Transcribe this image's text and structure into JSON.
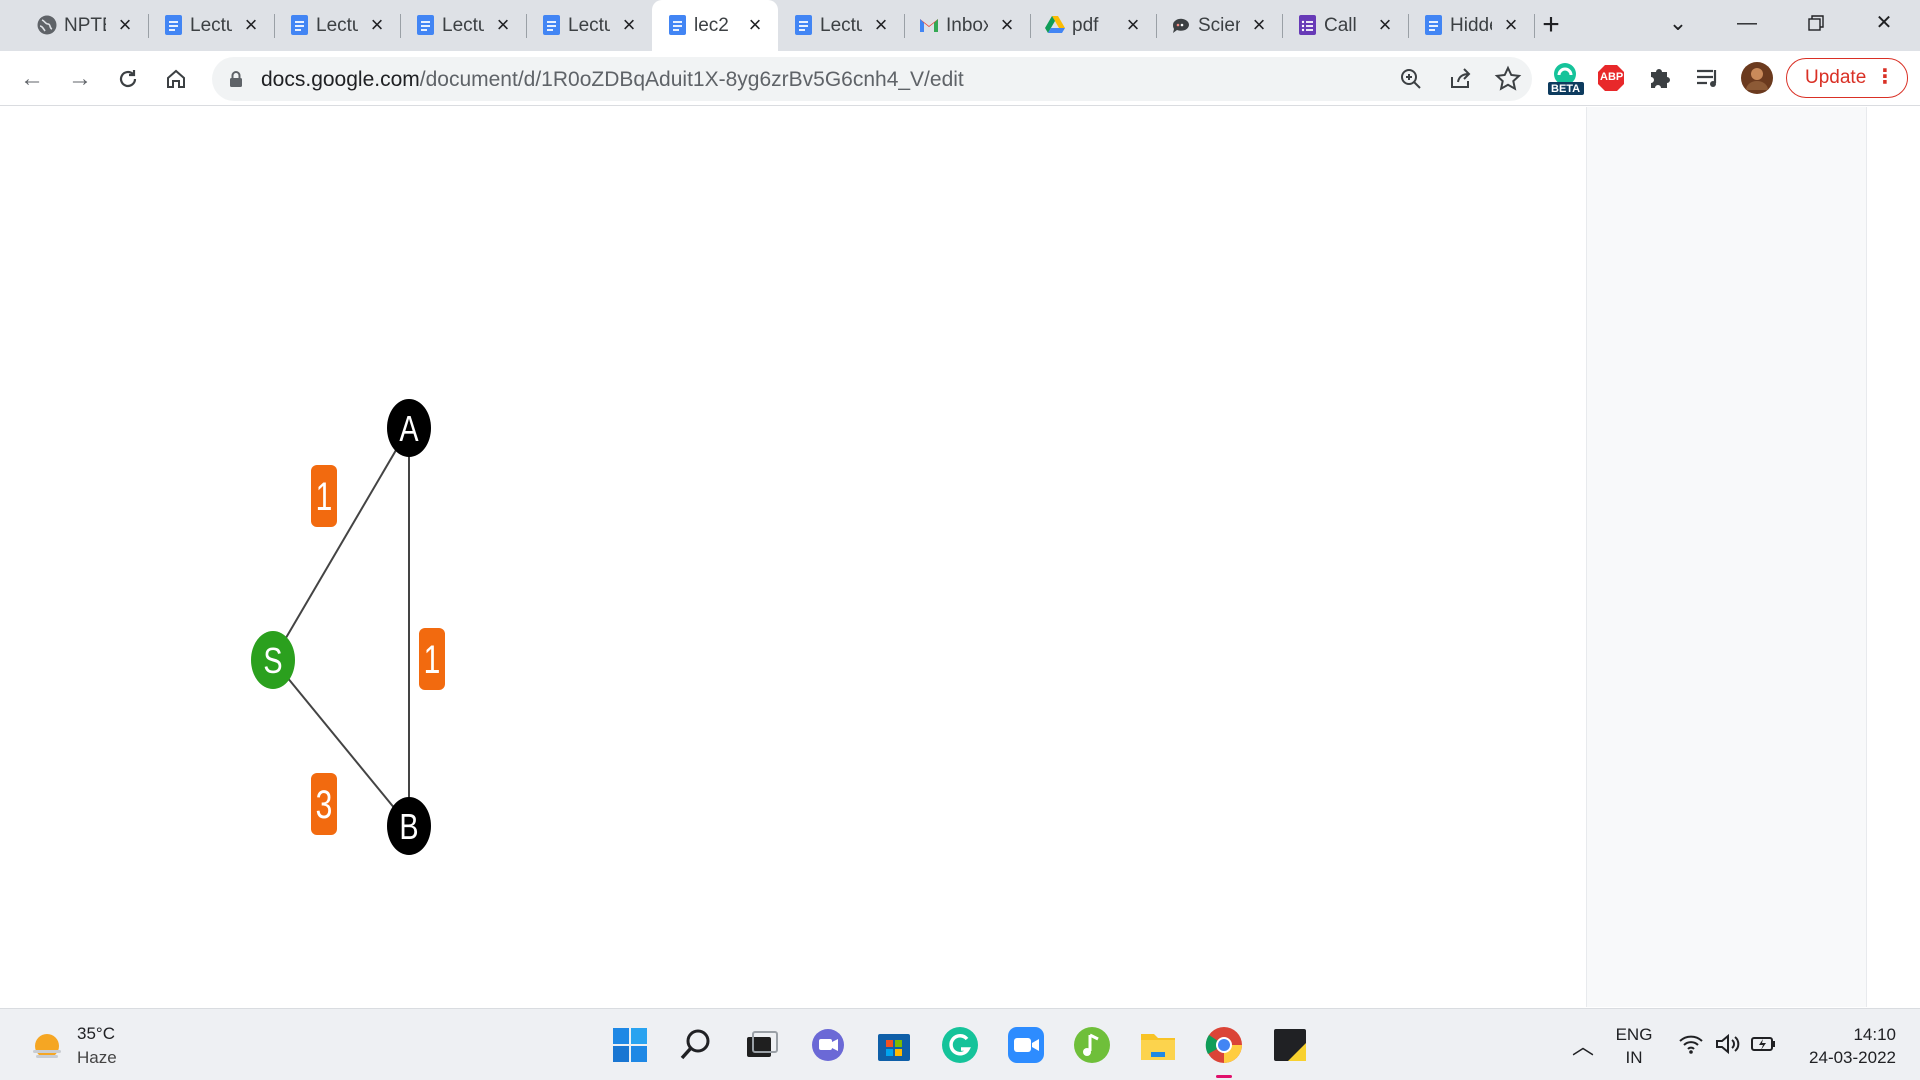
{
  "browser": {
    "tabs": [
      {
        "title": "NPTEL",
        "icon": "globe-icon"
      },
      {
        "title": "Lecture",
        "icon": "google-docs-icon"
      },
      {
        "title": "Lecture",
        "icon": "google-docs-icon"
      },
      {
        "title": "Lecture",
        "icon": "google-docs-icon"
      },
      {
        "title": "Lecture",
        "icon": "google-docs-icon"
      },
      {
        "title": "lec2",
        "icon": "google-docs-icon",
        "active": true
      },
      {
        "title": "Lecture",
        "icon": "google-docs-icon"
      },
      {
        "title": "Inbox",
        "icon": "gmail-icon"
      },
      {
        "title": "pdf",
        "icon": "google-drive-icon"
      },
      {
        "title": "Science",
        "icon": "chat-icon"
      },
      {
        "title": "Call",
        "icon": "google-forms-icon"
      },
      {
        "title": "Hidden",
        "icon": "google-docs-icon"
      }
    ],
    "url_host": "docs.google.com",
    "url_path": "/document/d/1R0oZDBqAduit1X-8yg6zrBv5G6cnh4_V/edit",
    "extension_badge": "BETA",
    "adblock_label": "ABP",
    "update_label": "Update"
  },
  "graph": {
    "nodes": [
      {
        "id": "A",
        "label": "A",
        "color": "#000000"
      },
      {
        "id": "S",
        "label": "S",
        "color": "#2ba01e"
      },
      {
        "id": "B",
        "label": "B",
        "color": "#000000"
      }
    ],
    "edges": [
      {
        "from": "S",
        "to": "A",
        "weight": "1"
      },
      {
        "from": "A",
        "to": "B",
        "weight": "1"
      },
      {
        "from": "S",
        "to": "B",
        "weight": "3"
      }
    ],
    "weight_color": "#f26a0f"
  },
  "taskbar": {
    "temperature": "35°C",
    "condition": "Haze",
    "language_top": "ENG",
    "language_bottom": "IN",
    "time": "14:10",
    "date": "24-03-2022"
  }
}
